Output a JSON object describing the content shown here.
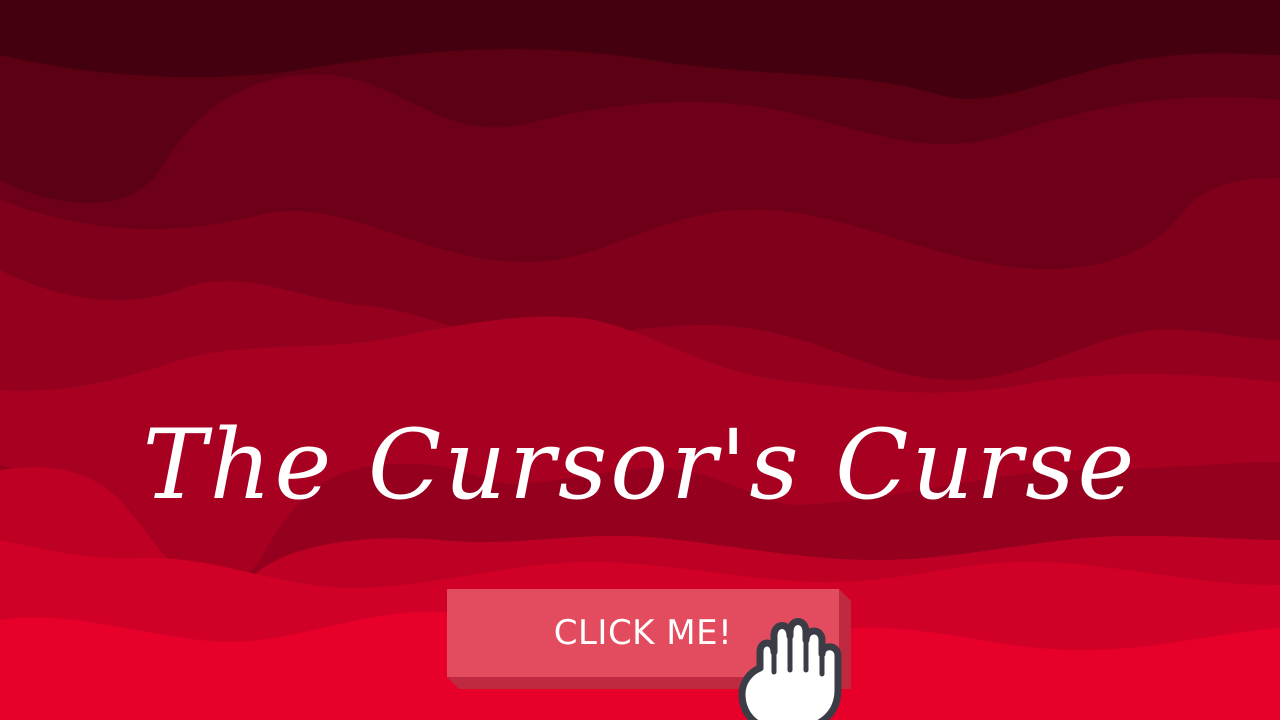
{
  "game": {
    "title": "The Cursor's Curse",
    "button_label": "CLICK ME!",
    "cursor_icon": "hand-grab-icon"
  },
  "colors": {
    "background_layers": [
      "#45000f",
      "#5c0014",
      "#6d0018",
      "#80001b",
      "#95001f",
      "#a80021",
      "#bd0024",
      "#d10027",
      "#e6002a"
    ],
    "button_face": "#e24c5e",
    "button_side": "#c02a40",
    "title_text": "#ffffff",
    "cursor_fill": "#ffffff",
    "cursor_outline": "#3c3c46"
  }
}
